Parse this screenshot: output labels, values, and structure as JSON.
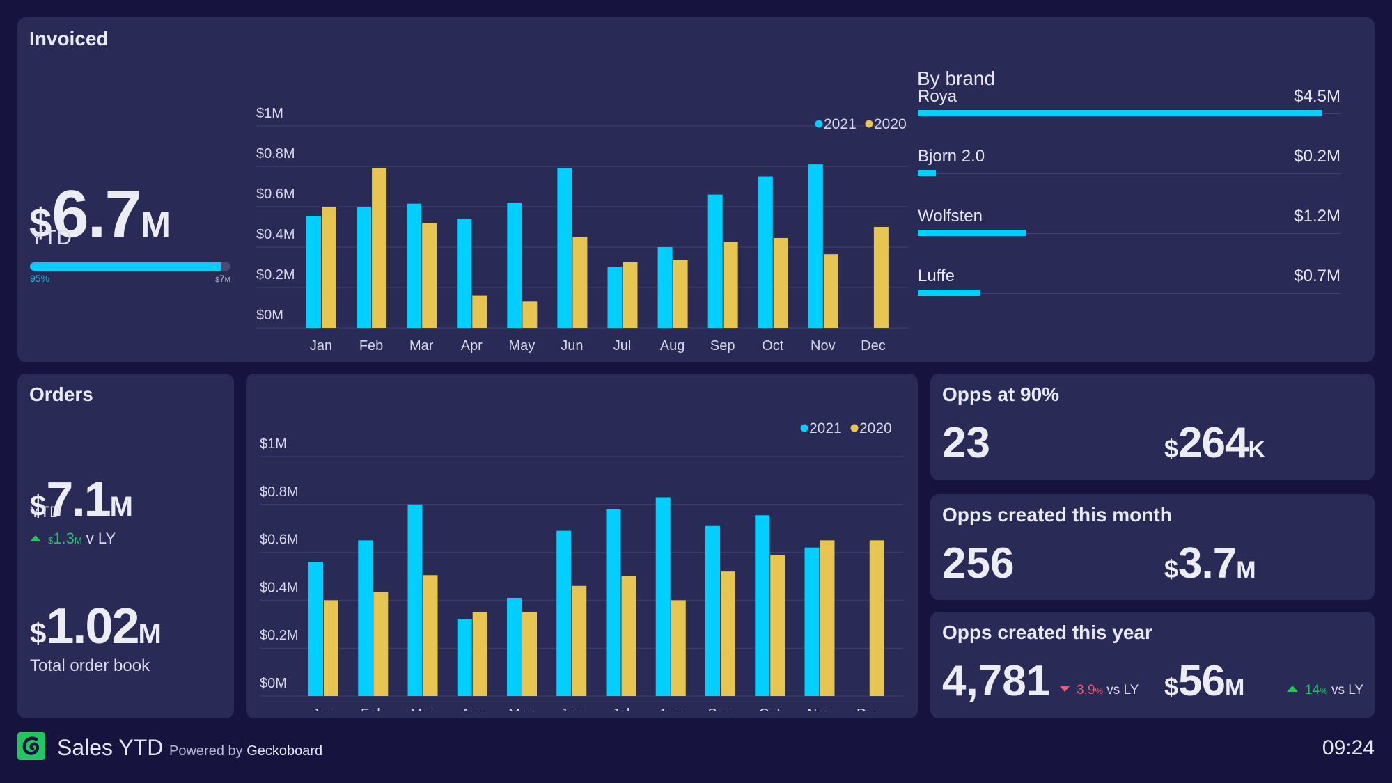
{
  "footer": {
    "dashboard_title": "Sales YTD",
    "powered_by_prefix": "Powered by",
    "powered_by_brand": "Geckoboard",
    "clock": "09:24",
    "logo_icon": "geckoboard-logo-icon"
  },
  "colors": {
    "background": "#16133f",
    "card": "#292a56",
    "series_2021": "#00cfff",
    "series_2020": "#e6c552",
    "positive": "#22c55e",
    "negative": "#f05a6a"
  },
  "invoiced": {
    "title": "Invoiced",
    "currency": "$",
    "value": "6.7",
    "unit": "M",
    "label": "YTD",
    "progress_fraction": 0.95,
    "progress_label": "95%",
    "target_currency": "$",
    "target_value": "7",
    "target_unit": "M"
  },
  "by_brand": {
    "title": "By brand",
    "max_value": 4.7,
    "items": [
      {
        "name": "Roya",
        "value_label": "$4.5M",
        "value": 4.5
      },
      {
        "name": "Bjorn 2.0",
        "value_label": "$0.2M",
        "value": 0.2
      },
      {
        "name": "Wolfsten",
        "value_label": "$1.2M",
        "value": 1.2
      },
      {
        "name": "Luffe",
        "value_label": "$0.7M",
        "value": 0.7
      }
    ]
  },
  "orders": {
    "title": "Orders",
    "ytd_currency": "$",
    "ytd_value": "7.1",
    "ytd_unit": "M",
    "ytd_label": "YTD",
    "delta_direction": "up",
    "delta_currency": "$",
    "delta_value": "1.3",
    "delta_unit": "M",
    "delta_suffix": "v LY",
    "book_currency": "$",
    "book_value": "1.02",
    "book_unit": "M",
    "book_label": "Total order book"
  },
  "opps_90": {
    "title": "Opps at 90%",
    "count": "23",
    "currency": "$",
    "value": "264",
    "unit": "K"
  },
  "opps_month": {
    "title": "Opps created this month",
    "count": "256",
    "currency": "$",
    "value": "3.7",
    "unit": "M"
  },
  "opps_year": {
    "title": "Opps created this year",
    "count": "4,781",
    "count_delta_direction": "down",
    "count_delta_value": "3.9",
    "count_delta_unit": "%",
    "count_delta_suffix": "vs LY",
    "currency": "$",
    "value": "56",
    "unit": "M",
    "value_delta_direction": "up",
    "value_delta_value": "14",
    "value_delta_unit": "%",
    "value_delta_suffix": "vs LY"
  },
  "chart_data": [
    {
      "id": "invoiced-monthly",
      "type": "bar",
      "title": "",
      "xlabel": "",
      "ylabel": "",
      "categories": [
        "Jan",
        "Feb",
        "Mar",
        "Apr",
        "May",
        "Jun",
        "Jul",
        "Aug",
        "Sep",
        "Oct",
        "Nov",
        "Dec"
      ],
      "ylim": [
        0,
        1
      ],
      "yticks": [
        0,
        0.2,
        0.4,
        0.6,
        0.8,
        1
      ],
      "ytick_labels": [
        "$0M",
        "$0.2M",
        "$0.4M",
        "$0.6M",
        "$0.8M",
        "$1M"
      ],
      "grid": true,
      "legend_position": "top-right",
      "series": [
        {
          "name": "2021",
          "color": "#00cfff",
          "values": [
            0.555,
            0.6,
            0.615,
            0.54,
            0.62,
            0.79,
            0.3,
            0.4,
            0.66,
            0.75,
            0.81,
            null
          ]
        },
        {
          "name": "2020",
          "color": "#e6c552",
          "values": [
            0.6,
            0.79,
            0.52,
            0.16,
            0.13,
            0.45,
            0.325,
            0.335,
            0.425,
            0.445,
            0.365,
            0.5
          ]
        }
      ]
    },
    {
      "id": "orders-monthly",
      "type": "bar",
      "title": "",
      "xlabel": "",
      "ylabel": "",
      "categories": [
        "Jan",
        "Feb",
        "Mar",
        "Apr",
        "May",
        "Jun",
        "Jul",
        "Aug",
        "Sep",
        "Oct",
        "Nov",
        "Dec"
      ],
      "ylim": [
        0,
        1
      ],
      "yticks": [
        0,
        0.2,
        0.4,
        0.6,
        0.8,
        1
      ],
      "ytick_labels": [
        "$0M",
        "$0.2M",
        "$0.4M",
        "$0.6M",
        "$0.8M",
        "$1M"
      ],
      "grid": true,
      "legend_position": "top-right",
      "series": [
        {
          "name": "2021",
          "color": "#00cfff",
          "values": [
            0.56,
            0.65,
            0.8,
            0.32,
            0.41,
            0.69,
            0.78,
            0.83,
            0.71,
            0.755,
            0.62,
            null
          ]
        },
        {
          "name": "2020",
          "color": "#e6c552",
          "values": [
            0.4,
            0.435,
            0.505,
            0.35,
            0.35,
            0.46,
            0.5,
            0.4,
            0.52,
            0.59,
            0.65,
            0.65
          ]
        }
      ]
    }
  ]
}
